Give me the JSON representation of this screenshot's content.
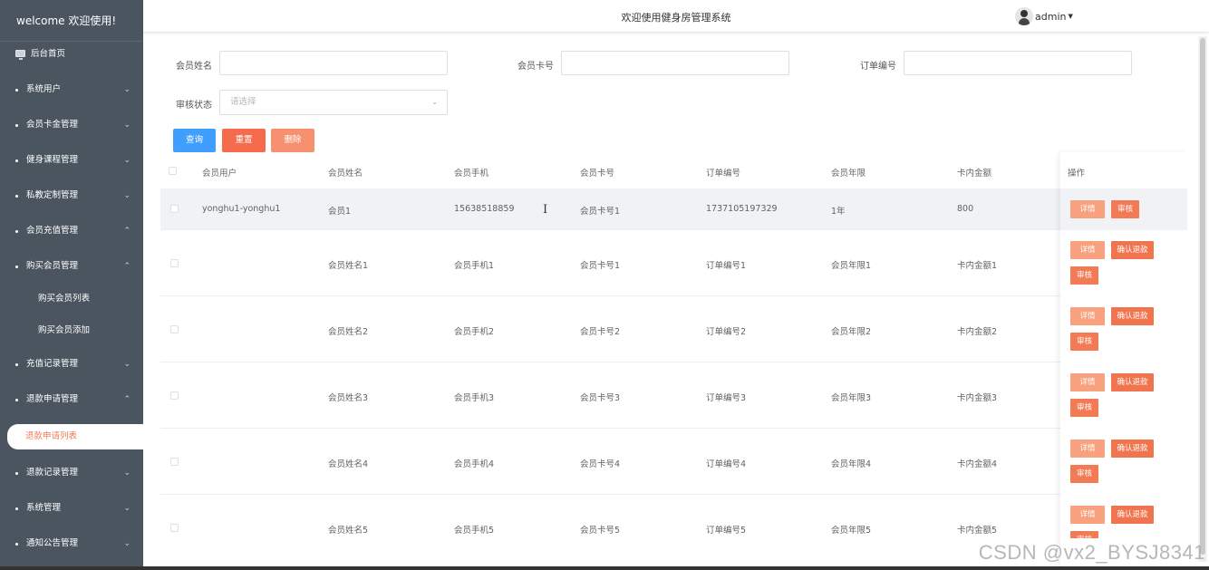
{
  "sidebar": {
    "brand": "welcome 欢迎使用!",
    "home": "后台首页",
    "items": [
      {
        "label": "系统用户",
        "expanded": false
      },
      {
        "label": "会员卡金管理",
        "expanded": false
      },
      {
        "label": "健身课程管理",
        "expanded": false
      },
      {
        "label": "私教定制管理",
        "expanded": false
      },
      {
        "label": "会员充值管理",
        "expanded": true
      },
      {
        "label": "购买会员管理",
        "expanded": true
      },
      {
        "label": "充值记录管理",
        "expanded": false
      },
      {
        "label": "退款申请管理",
        "expanded": true
      },
      {
        "label": "退款记录管理",
        "expanded": false
      },
      {
        "label": "系统管理",
        "expanded": false
      },
      {
        "label": "通知公告管理",
        "expanded": false
      }
    ],
    "subitems": {
      "buy_list": "购买会员列表",
      "buy_add": "购买会员添加",
      "refund_list": "退款申请列表"
    },
    "colors": {
      "bg": "#4a5560",
      "active_text": "#ef7d59"
    }
  },
  "header": {
    "title": "欢迎使用健身房管理系统",
    "username": "admin"
  },
  "filters": {
    "member_name_label": "会员姓名",
    "member_card_label": "会员卡号",
    "order_no_label": "订单编号",
    "status_label": "审核状态",
    "status_placeholder": "请选择",
    "query_button": "查询",
    "reset_button": "重置",
    "delete_button": "删除"
  },
  "table": {
    "columns": [
      "会员用户",
      "会员姓名",
      "会员手机",
      "会员卡号",
      "订单编号",
      "会员年限",
      "卡内金额",
      "操作"
    ],
    "rows": [
      {
        "user": "yonghu1-yonghu1",
        "name": "会员1",
        "phone": "15638518859",
        "card": "会员卡号1",
        "order": "1737105197329",
        "years": "1年",
        "amount": "800",
        "refund": false
      },
      {
        "user": "",
        "name": "会员姓名1",
        "phone": "会员手机1",
        "card": "会员卡号1",
        "order": "订单编号1",
        "years": "会员年限1",
        "amount": "卡内金额1",
        "refund": true
      },
      {
        "user": "",
        "name": "会员姓名2",
        "phone": "会员手机2",
        "card": "会员卡号2",
        "order": "订单编号2",
        "years": "会员年限2",
        "amount": "卡内金额2",
        "refund": true
      },
      {
        "user": "",
        "name": "会员姓名3",
        "phone": "会员手机3",
        "card": "会员卡号3",
        "order": "订单编号3",
        "years": "会员年限3",
        "amount": "卡内金额3",
        "refund": true
      },
      {
        "user": "",
        "name": "会员姓名4",
        "phone": "会员手机4",
        "card": "会员卡号4",
        "order": "订单编号4",
        "years": "会员年限4",
        "amount": "卡内金额4",
        "refund": true
      },
      {
        "user": "",
        "name": "会员姓名5",
        "phone": "会员手机5",
        "card": "会员卡号5",
        "order": "订单编号5",
        "years": "会员年限5",
        "amount": "卡内金额5",
        "refund": true
      }
    ],
    "ops": {
      "detail": "详情",
      "audit": "审核",
      "refund_confirm": "确认退款"
    }
  },
  "watermark": "CSDN @vx2_BYSJ8341"
}
